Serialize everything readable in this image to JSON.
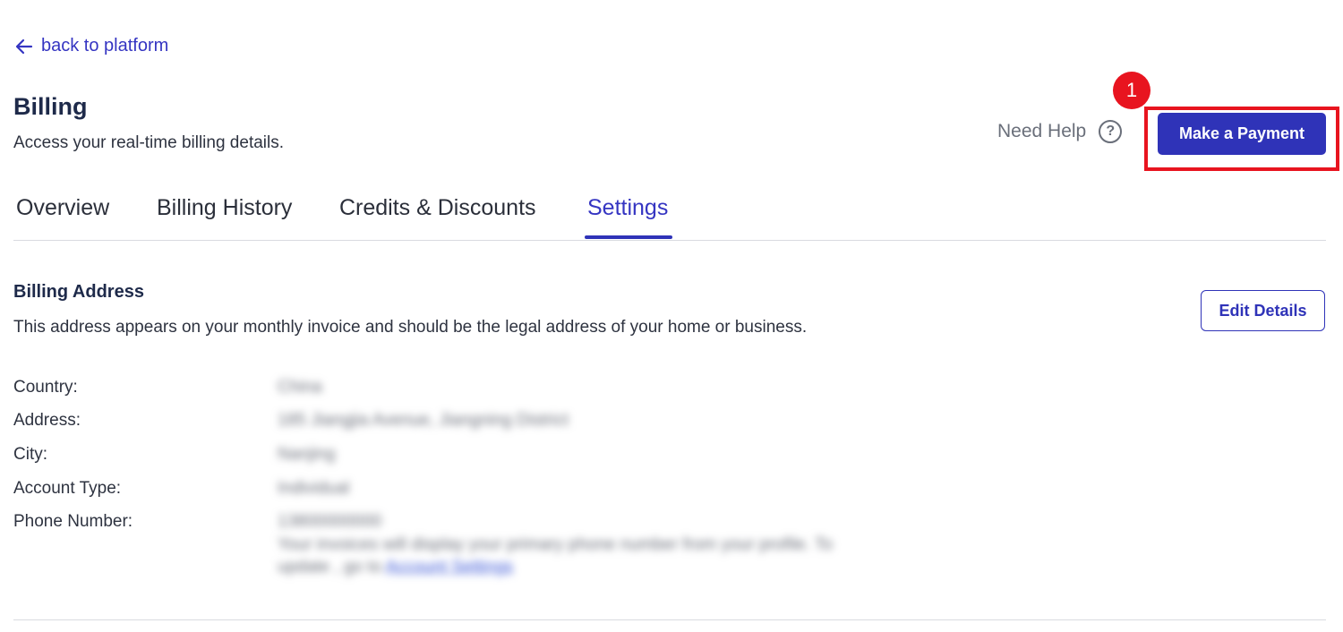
{
  "nav": {
    "back_label": "back to platform"
  },
  "header": {
    "title": "Billing",
    "subtitle": "Access your real-time billing details.",
    "help_label": "Need Help",
    "help_icon_glyph": "?",
    "pay_button_label": "Make a Payment",
    "step_badge": "1"
  },
  "tabs": [
    {
      "label": "Overview",
      "active": false
    },
    {
      "label": "Billing History",
      "active": false
    },
    {
      "label": "Credits & Discounts",
      "active": false
    },
    {
      "label": "Settings",
      "active": true
    }
  ],
  "billing_address": {
    "title": "Billing Address",
    "description": "This address appears on your monthly invoice and should be the legal address of your home or business.",
    "edit_button_label": "Edit Details",
    "fields": [
      {
        "label": "Country:",
        "value": "China"
      },
      {
        "label": "Address:",
        "value": "185 Jiangjia Avenue, Jiangning District"
      },
      {
        "label": "City:",
        "value": "Nanjing"
      },
      {
        "label": "Account Type:",
        "value": "Individual"
      },
      {
        "label": "Phone Number:",
        "value": "13800000000"
      }
    ],
    "phone_note_line1": "Your invoices will display your primary phone number from your profile. To",
    "phone_note_line2_prefix": "update , go to",
    "phone_note_link": "Account Settings"
  },
  "colors": {
    "accent": "#2f33b8",
    "link": "#3535c2",
    "highlight": "#e8141f"
  }
}
